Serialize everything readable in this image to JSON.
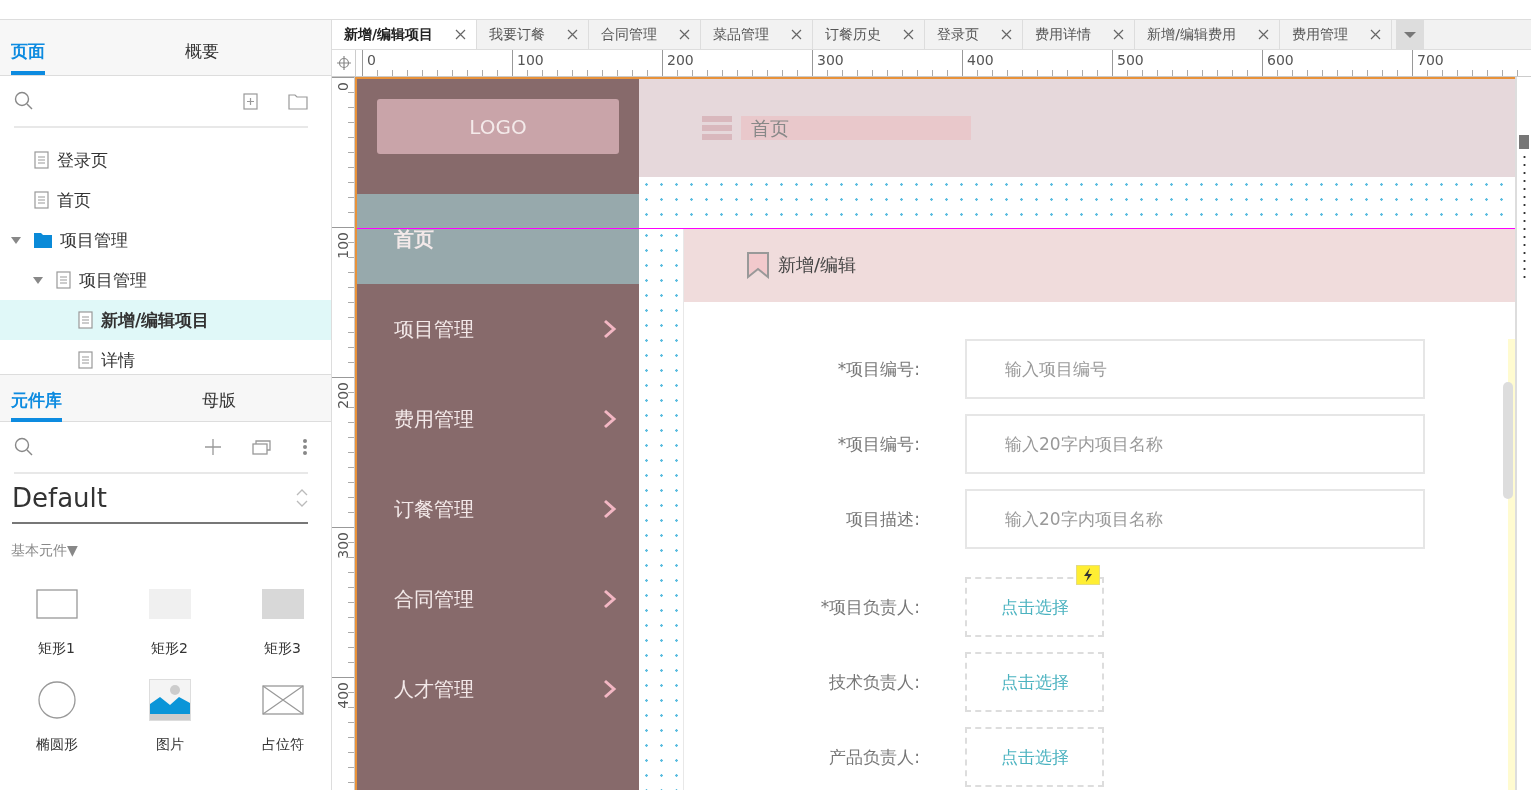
{
  "left_panel": {
    "tabs": [
      {
        "label": "页面",
        "selected": true
      },
      {
        "label": "概要",
        "selected": false
      }
    ],
    "pages": [
      {
        "label": "登录页",
        "kind": "page",
        "selected": false
      },
      {
        "label": "首页",
        "kind": "page",
        "selected": false
      },
      {
        "label": "项目管理",
        "kind": "folder",
        "selected": false,
        "expanded": true,
        "children": [
          {
            "label": "项目管理",
            "kind": "page",
            "selected": false,
            "expanded": true,
            "children": [
              {
                "label": "新增/编辑项目",
                "kind": "page",
                "selected": true
              },
              {
                "label": "详情",
                "kind": "page",
                "selected": false
              }
            ]
          }
        ]
      }
    ],
    "library_tabs": [
      {
        "label": "元件库",
        "selected": true
      },
      {
        "label": "母版",
        "selected": false
      }
    ],
    "library_name": "Default",
    "section": "基本元件▼",
    "widgets": [
      {
        "label": "矩形1",
        "kind": "rect-outline"
      },
      {
        "label": "矩形2",
        "kind": "rect-light"
      },
      {
        "label": "矩形3",
        "kind": "rect-gray"
      },
      {
        "label": "椭圆形",
        "kind": "ellipse"
      },
      {
        "label": "图片",
        "kind": "image"
      },
      {
        "label": "占位符",
        "kind": "placeholder"
      }
    ]
  },
  "document_tabs": [
    {
      "label": "新增/编辑项目",
      "selected": true
    },
    {
      "label": "我要订餐",
      "selected": false
    },
    {
      "label": "合同管理",
      "selected": false
    },
    {
      "label": "菜品管理",
      "selected": false
    },
    {
      "label": "订餐历史",
      "selected": false
    },
    {
      "label": "登录页",
      "selected": false
    },
    {
      "label": "费用详情",
      "selected": false
    },
    {
      "label": "新增/编辑费用",
      "selected": false
    },
    {
      "label": "费用管理",
      "selected": false
    }
  ],
  "ruler": {
    "x_labels": [
      "0",
      "100",
      "200",
      "300",
      "400",
      "500",
      "600",
      "700"
    ],
    "y_labels": [
      "0",
      "100",
      "200",
      "300",
      "400"
    ]
  },
  "canvas": {
    "logo": "LOGO",
    "header_title": "首页",
    "panel_title": "新增/编辑",
    "menu": [
      {
        "label": "首页",
        "selected": true,
        "has_submenu": false
      },
      {
        "label": "项目管理",
        "selected": false,
        "has_submenu": true
      },
      {
        "label": "费用管理",
        "selected": false,
        "has_submenu": true
      },
      {
        "label": "订餐管理",
        "selected": false,
        "has_submenu": true
      },
      {
        "label": "合同管理",
        "selected": false,
        "has_submenu": true
      },
      {
        "label": "人才管理",
        "selected": false,
        "has_submenu": true
      }
    ],
    "form": [
      {
        "label": "*项目编号:",
        "kind": "text",
        "placeholder": "输入项目编号"
      },
      {
        "label": "*项目编号:",
        "kind": "text",
        "placeholder": "输入20字内项目名称"
      },
      {
        "label": "项目描述:",
        "kind": "text",
        "placeholder": "输入20字内项目名称"
      },
      {
        "label": "*项目负责人:",
        "kind": "picker",
        "value": "点击选择",
        "has_interaction": true
      },
      {
        "label": "技术负责人:",
        "kind": "picker",
        "value": "点击选择",
        "has_interaction": false
      },
      {
        "label": "产品负责人:",
        "kind": "picker",
        "value": "点击选择",
        "has_interaction": false
      }
    ]
  }
}
